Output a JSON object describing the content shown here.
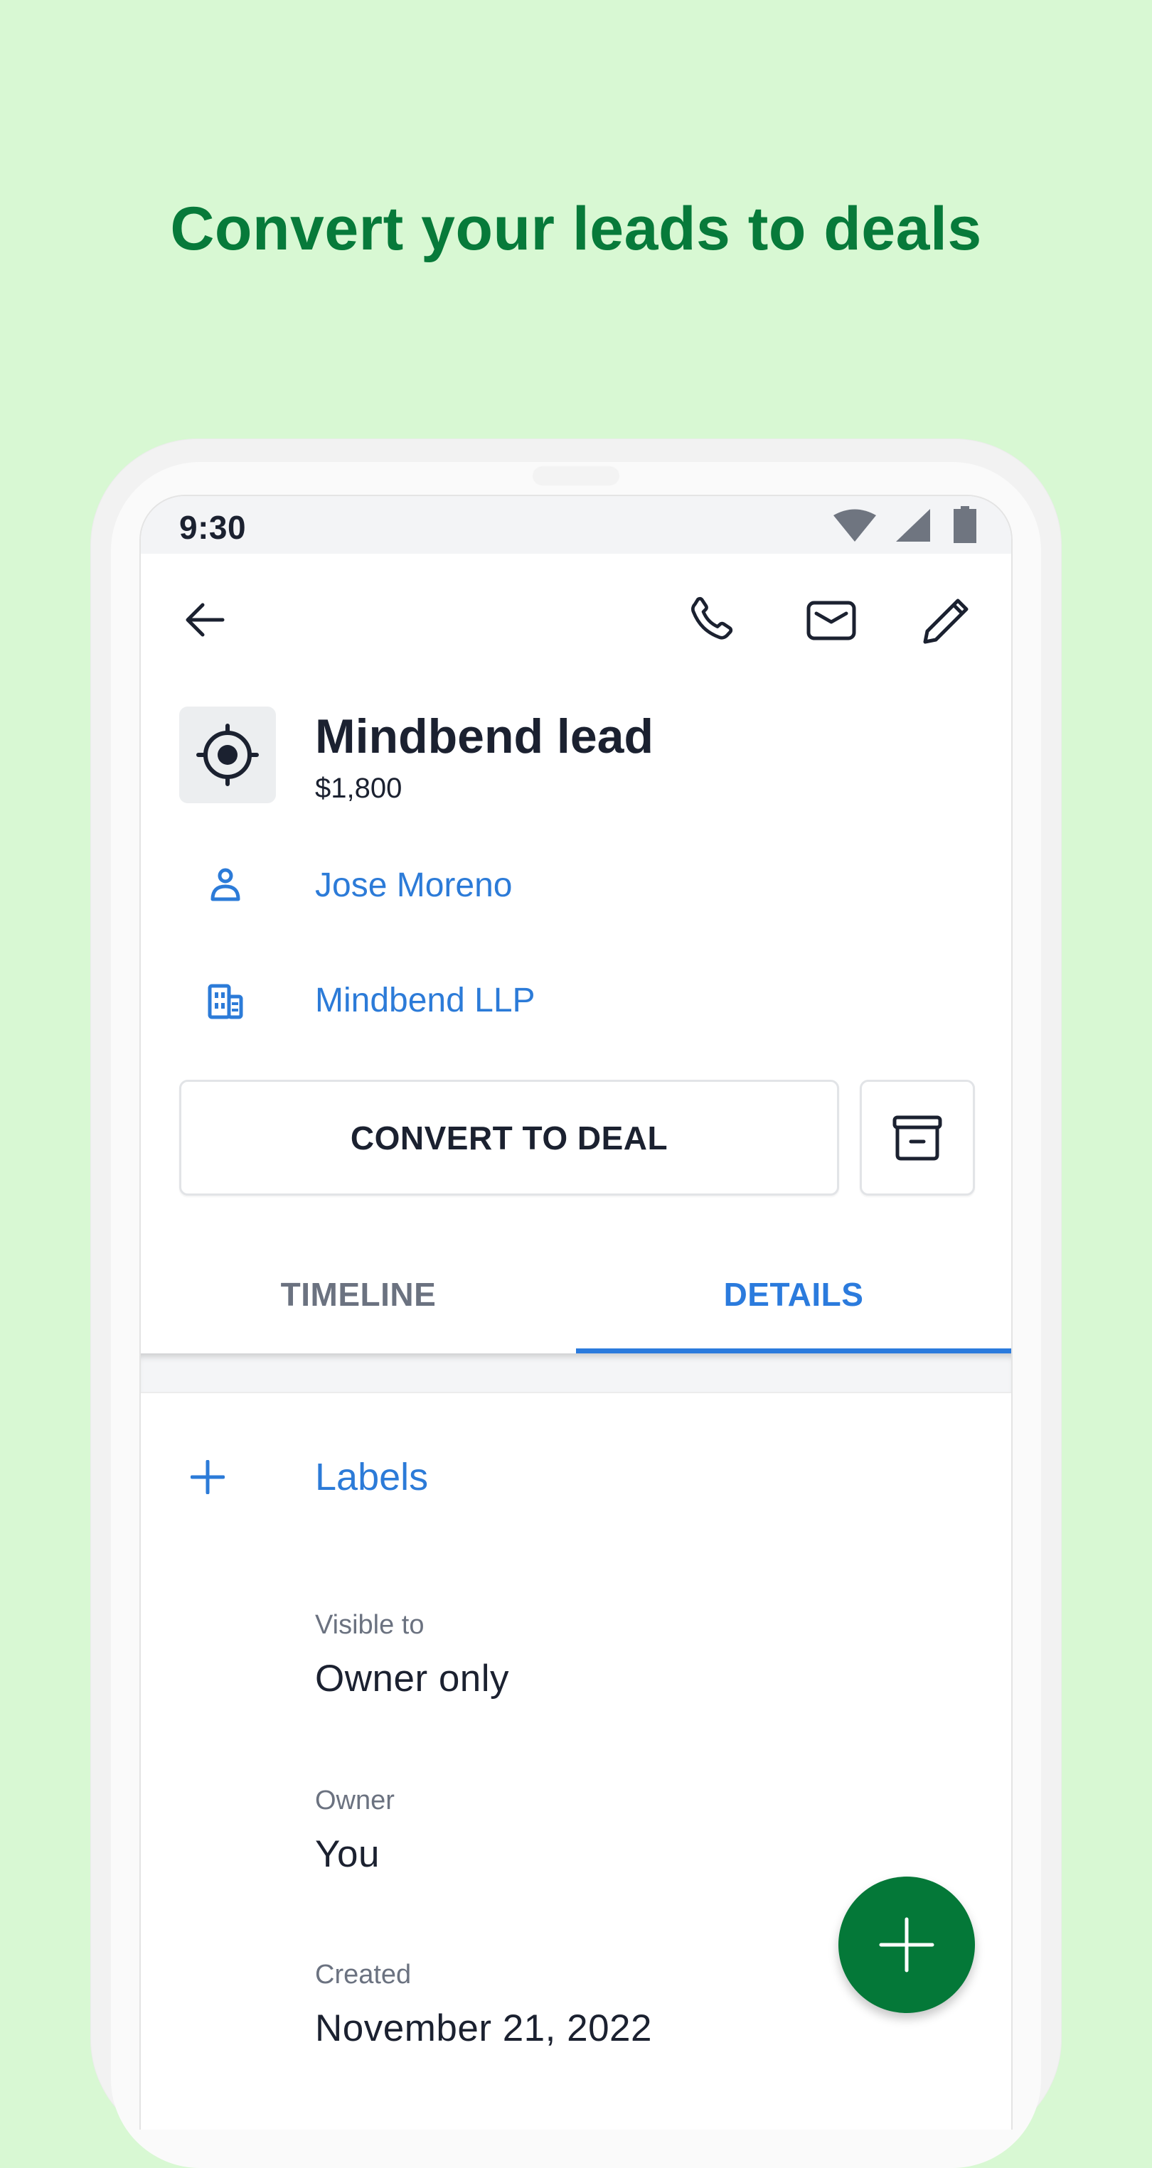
{
  "headline": "Convert your leads to deals",
  "status_bar": {
    "time": "9:30",
    "icons": [
      "wifi-icon",
      "signal-icon",
      "battery-icon"
    ]
  },
  "toolbar": {
    "back_icon": "arrow-left-icon",
    "actions": [
      "phone-icon",
      "mail-icon",
      "pencil-icon"
    ]
  },
  "lead": {
    "icon": "target-icon",
    "title": "Mindbend lead",
    "amount": "$1,800"
  },
  "links": [
    {
      "icon": "person-icon",
      "label": "Jose Moreno"
    },
    {
      "icon": "building-icon",
      "label": "Mindbend LLP"
    }
  ],
  "actions": {
    "convert_label": "CONVERT TO DEAL",
    "archive_icon": "archive-icon"
  },
  "tabs": [
    {
      "label": "TIMELINE",
      "active": false
    },
    {
      "label": "DETAILS",
      "active": true
    }
  ],
  "details": {
    "labels_action": "Labels",
    "fields": [
      {
        "label": "Visible to",
        "value": "Owner only"
      },
      {
        "label": "Owner",
        "value": "You"
      },
      {
        "label": "Created",
        "value": "November 21, 2022"
      }
    ]
  },
  "fab": {
    "icon": "plus-icon"
  },
  "colors": {
    "background": "#d8f8d3",
    "headline": "#077a3a",
    "link_blue": "#2c7bd8",
    "fab_green": "#047838",
    "text_dark": "#1b2130",
    "text_muted": "#6b7280"
  }
}
